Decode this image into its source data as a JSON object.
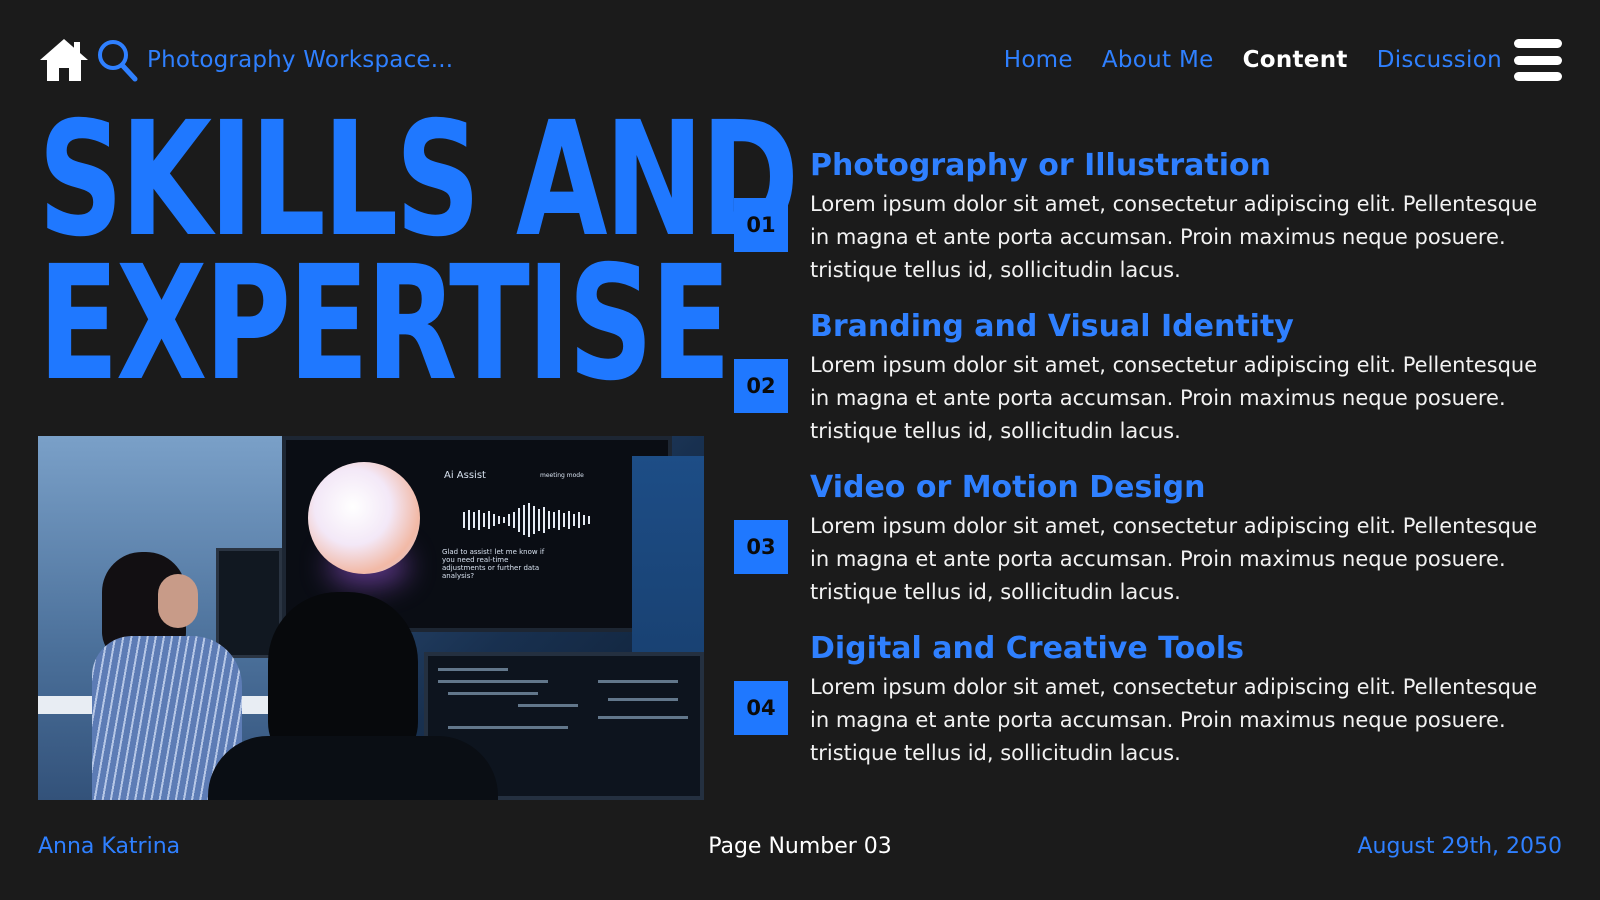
{
  "header": {
    "brand_title": "Photography Workspace...",
    "nav": [
      {
        "label": "Home",
        "active": false
      },
      {
        "label": "About Me",
        "active": false
      },
      {
        "label": "Content",
        "active": true
      },
      {
        "label": "Discussion",
        "active": false
      }
    ],
    "icons": [
      "home-icon",
      "search-icon",
      "hamburger-menu-icon"
    ]
  },
  "hero": {
    "line1": "SKILLS AND",
    "line2": "EXPERTISE"
  },
  "photo": {
    "screen_label": "Ai Assist",
    "screen_mode": "meeting mode",
    "screen_message": "Glad to assist! let me know if you need real-time adjustments or further data analysis?"
  },
  "skills": [
    {
      "number": "01",
      "title": "Photography or Illustration",
      "body": "Lorem ipsum dolor sit amet, consectetur adipiscing elit. Pellentesque in magna et ante porta accumsan. Proin maximus neque posuere. tristique tellus id, sollicitudin lacus."
    },
    {
      "number": "02",
      "title": "Branding and Visual Identity",
      "body": "Lorem ipsum dolor sit amet, consectetur adipiscing elit. Pellentesque in magna et ante porta accumsan. Proin maximus neque posuere. tristique tellus id, sollicitudin lacus."
    },
    {
      "number": "03",
      "title": "Video or Motion Design",
      "body": "Lorem ipsum dolor sit amet, consectetur adipiscing elit. Pellentesque in magna et ante porta accumsan. Proin maximus neque posuere. tristique tellus id, sollicitudin lacus."
    },
    {
      "number": "04",
      "title": "Digital and Creative Tools",
      "body": "Lorem ipsum dolor sit amet, consectetur adipiscing elit. Pellentesque in magna et ante porta accumsan. Proin maximus neque posuere. tristique tellus id, sollicitudin lacus."
    }
  ],
  "footer": {
    "author": "Anna Katrina",
    "page": "Page Number 03",
    "date": "August 29th, 2050"
  },
  "colors": {
    "background": "#1b1b1b",
    "accent": "#1f78ff",
    "text": "#ffffff"
  }
}
